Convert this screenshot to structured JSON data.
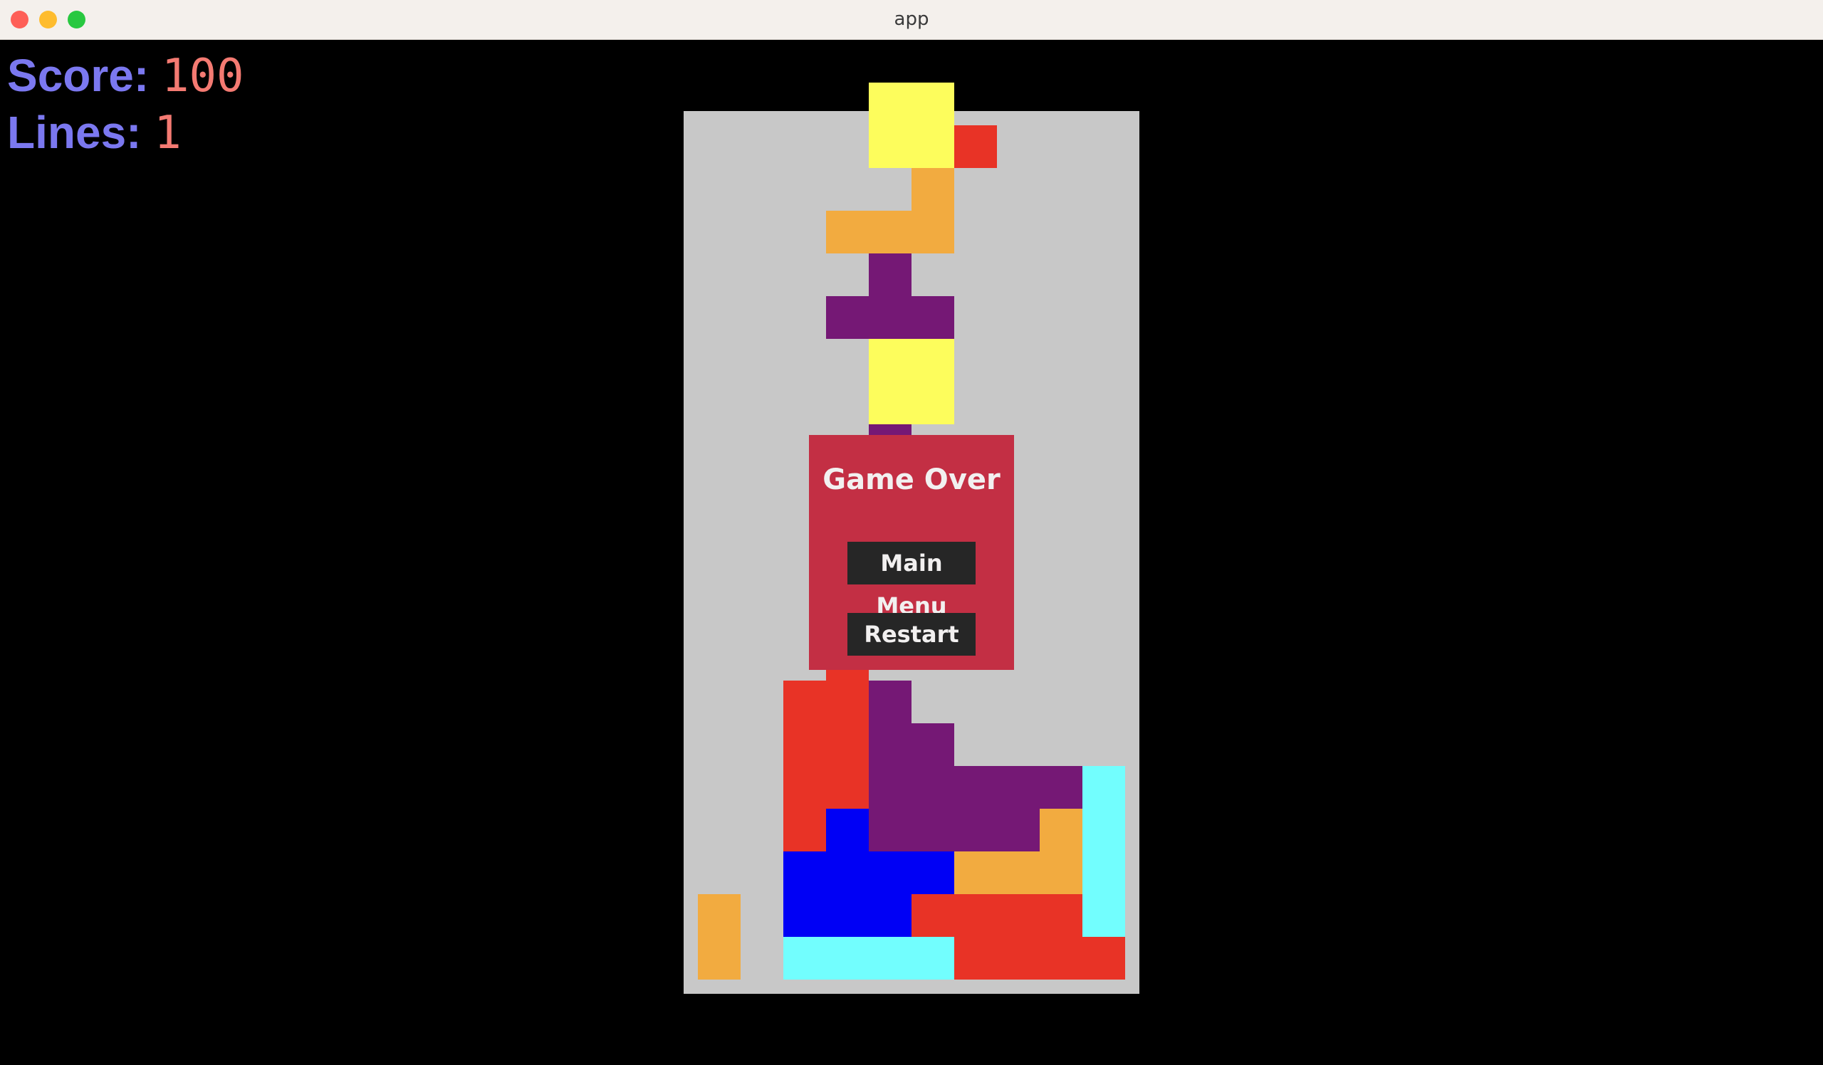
{
  "window": {
    "title": "app"
  },
  "hud": {
    "score_label": "Score:",
    "score_value": "100",
    "lines_label": "Lines:",
    "lines_value": "1"
  },
  "dialog": {
    "title": "Game Over",
    "main_menu_label": "Main Menu",
    "restart_label": "Restart"
  },
  "colors": {
    "Y": "#fdfd5c",
    "R": "#e83326",
    "O": "#f2ab40",
    "P": "#751875",
    "B": "#0000f5",
    "C": "#72fefe",
    "hud_label": "#7b78f0",
    "hud_value": "#f47a72",
    "dialog_bg": "#c32f44",
    "button_bg": "#262626",
    "well_border": "#c8c8c8"
  },
  "board": {
    "columns": 10,
    "rows": [
      "....YY....",
      "....YYR...",
      ".....O....",
      "...OOO....",
      "....P.....",
      "...PPP....",
      "....YY....",
      "....YY....",
      "....P.....",
      "..........",
      "..........",
      "..........",
      "..........",
      "...R......",
      "..RRP.....",
      "..RRPP....",
      "..RRPPPPPC",
      "..RBPPPPOC",
      "..BBBBOOOC",
      "O.BBBRRRRC",
      "O.CCCCRRRR"
    ]
  }
}
